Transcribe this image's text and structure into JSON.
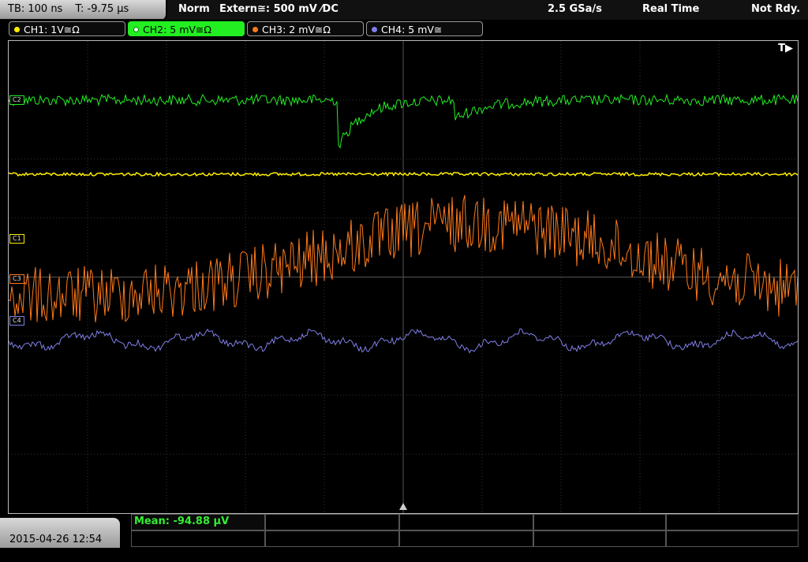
{
  "topbar": {
    "timebase": "TB: 100 ns",
    "trigger_time": "T: -9.75 µs",
    "mode": "Norm",
    "trigger_source": "Extern≅: 500 mV ⁄DC",
    "sample_rate": "2.5 GSa/s",
    "acq_mode": "Real Time",
    "state": "Not Rdy."
  },
  "channels": [
    {
      "label": "CH1: 1V≅Ω",
      "color": "#ffee00"
    },
    {
      "label": "CH2: 5 mV≅Ω",
      "color": "#22ee22"
    },
    {
      "label": "CH3: 2 mV≅Ω",
      "color": "#ff7a1a"
    },
    {
      "label": "CH4: 5 mV≅",
      "color": "#7f7fe8"
    }
  ],
  "markers": {
    "c1": "C1",
    "c2": "C2",
    "c3": "C3",
    "c4": "C4"
  },
  "trigger_flag": "T▶",
  "date": "2015-04-26 12:54",
  "measurement": {
    "mean": "Mean: -94.88 µV"
  }
}
